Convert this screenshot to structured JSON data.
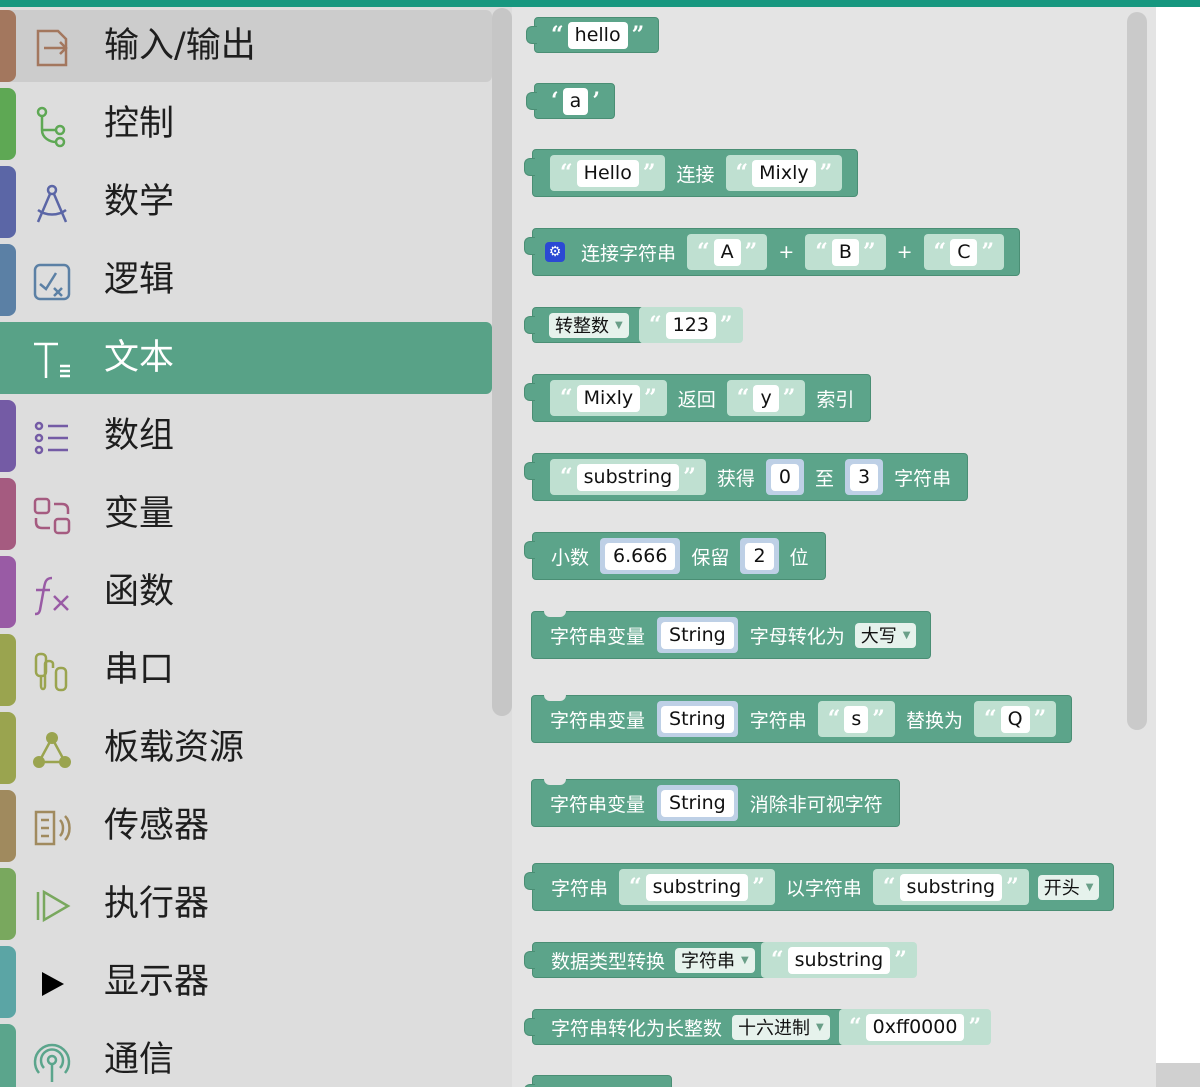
{
  "sidebar": {
    "categories": [
      {
        "label": "输入/输出",
        "color": "#a3775e",
        "icon": "input-output-icon"
      },
      {
        "label": "控制",
        "color": "#5ea854",
        "icon": "control-flow-icon"
      },
      {
        "label": "数学",
        "color": "#5b66a6",
        "icon": "compass-icon"
      },
      {
        "label": "逻辑",
        "color": "#5b80a5",
        "icon": "logic-check-icon"
      },
      {
        "label": "文本",
        "color": "#5ba58c",
        "icon": "text-icon"
      },
      {
        "label": "数组",
        "color": "#745ba5",
        "icon": "list-icon"
      },
      {
        "label": "变量",
        "color": "#a55b80",
        "icon": "variable-swap-icon"
      },
      {
        "label": "函数",
        "color": "#995ba5",
        "icon": "function-fx-icon"
      },
      {
        "label": "串口",
        "color": "#9aa44f",
        "icon": "serial-plug-icon"
      },
      {
        "label": "板载资源",
        "color": "#9aa44f",
        "icon": "board-resource-icon"
      },
      {
        "label": "传感器",
        "color": "#a08a5e",
        "icon": "sensor-icon"
      },
      {
        "label": "执行器",
        "color": "#79a85e",
        "icon": "actuator-play-icon"
      },
      {
        "label": "显示器",
        "color": "#5ba5a5",
        "icon": "display-play-icon"
      },
      {
        "label": "通信",
        "color": "#5ba58c",
        "icon": "communication-antenna-icon"
      }
    ],
    "selected": "文本"
  },
  "blocks": {
    "b1": {
      "text": "hello"
    },
    "b2": {
      "char": "a"
    },
    "b3": {
      "left": "Hello",
      "join": "连接",
      "right": "Mixly"
    },
    "b4": {
      "label": "连接字符串",
      "a": "A",
      "plus1": "+",
      "b": "B",
      "plus2": "+",
      "c": "C"
    },
    "b5": {
      "dropdown": "转整数",
      "value": "123"
    },
    "b6": {
      "text": "Mixly",
      "ret": "返回",
      "find": "y",
      "idx": "索引"
    },
    "b7": {
      "text": "substring",
      "get": "获得",
      "from": "0",
      "to_kw": "至",
      "to": "3",
      "tail": "字符串"
    },
    "b8": {
      "label": "小数",
      "value": "6.666",
      "keep": "保留",
      "digits": "2",
      "unit": "位"
    },
    "b9": {
      "label": "字符串变量",
      "var": "String",
      "op": "字母转化为",
      "dropdown": "大写"
    },
    "b10": {
      "label": "字符串变量",
      "var": "String",
      "kw": "字符串",
      "from": "s",
      "replace": "替换为",
      "to": "Q"
    },
    "b11": {
      "label": "字符串变量",
      "var": "String",
      "op": "消除非可视字符"
    },
    "b12": {
      "label": "字符串",
      "a": "substring",
      "kw": "以字符串",
      "b": "substring",
      "dropdown": "开头"
    },
    "b13": {
      "label": "数据类型转换",
      "dropdown": "字符串",
      "value": "substring"
    },
    "b14": {
      "label": "字符串转化为长整数",
      "dropdown": "十六进制",
      "value": "0xff0000"
    }
  }
}
